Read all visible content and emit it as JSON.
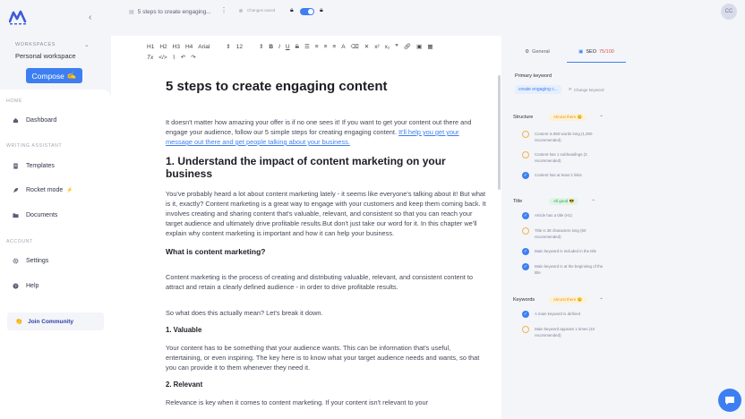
{
  "sidebar": {
    "workspaces_label": "WORKSPACES",
    "workspace_name": "Personal workspace",
    "compose_label": "Compose",
    "compose_emoji": "✍",
    "sections": {
      "home": "HOME",
      "writing": "WRITING ASSISTANT",
      "account": "ACCOUNT"
    },
    "items": [
      {
        "label": "Dashboard",
        "icon": "home-icon"
      },
      {
        "label": "Templates",
        "icon": "document-icon"
      },
      {
        "label": "Rocket mode",
        "icon": "rocket-icon",
        "badge": "⚡"
      },
      {
        "label": "Documents",
        "icon": "folder-icon"
      },
      {
        "label": "Settings",
        "icon": "gear-icon"
      },
      {
        "label": "Help",
        "icon": "help-icon"
      }
    ],
    "community_label": "Join Community",
    "community_emoji": "👏"
  },
  "topbar": {
    "doc_title": "5 steps to create engaging...",
    "saved_text": "Changes saved",
    "avatar_initials": "CC"
  },
  "toolbar": {
    "headings": [
      "H1",
      "H2",
      "H3",
      "H4"
    ],
    "font": "Arial",
    "size": "12"
  },
  "document": {
    "title": "5 steps to create engaging content",
    "intro": "It doesn't matter how amazing your offer is if no one sees it! If you want to get your content out there and engage your audience, follow our 5 simple steps for creating engaging content. ",
    "intro_link": "It'll help you get your message out there and get people talking about your business.",
    "h2_1": "1. Understand the impact of content marketing on your business",
    "p1": "You've probably heard a lot about content marketing lately - it seems like everyone's talking about it! But what is it, exactly? Content marketing is a great way to engage with your customers and keep them coming back. It involves creating and sharing content that's valuable, relevant, and consistent so that you can reach your target audience and ultimately drive profitable results.But don't just take our word for it. In this chapter we'll explain why content marketing is important and how it can help your business.",
    "h3_1": "What is content marketing?",
    "p2": "Content marketing is the process of creating and distributing valuable, relevant, and consistent content to attract and retain a clearly defined audience - in order to drive profitable results.",
    "p3": "So what does this actually mean? Let's break it down.",
    "h4_1": "1. Valuable",
    "p4": "Your content has to be something that your audience wants. This can be information that's useful, entertaining, or even inspiring. The key here is to know what your target audience needs and wants, so that you can provide it to them whenever they need it.",
    "h4_2": "2. Relevant",
    "p5": "Relevance is key when it comes to content marketing. If your content isn't relevant to your"
  },
  "panel": {
    "tab_general": "General",
    "tab_seo": "SEO",
    "seo_score": "75/100",
    "primary_keyword_label": "Primary keyword",
    "keyword": "create engaging c...",
    "change_keyword": "Change keyword",
    "structure": {
      "title": "Structure",
      "badge": "Almost there 😊",
      "checks": [
        {
          "text": "Content is 860 words long (1,000 recommended)",
          "done": false
        },
        {
          "text": "Content has 1 subheadings (3 recommended)",
          "done": false
        },
        {
          "text": "Content has at least 2 links",
          "done": true
        }
      ]
    },
    "title_sec": {
      "title": "Title",
      "badge": "All good 😎",
      "checks": [
        {
          "text": "Article has a title (H1)",
          "done": true
        },
        {
          "text": "Title is 38 characters long (60 recommended)",
          "done": false
        },
        {
          "text": "Main keyword is included in the title",
          "done": true
        },
        {
          "text": "Main keyword is at the beginning of the title",
          "done": true
        }
      ]
    },
    "keywords": {
      "title": "Keywords",
      "badge": "Almost there 😊",
      "checks": [
        {
          "text": "A main keyword is defined",
          "done": true
        },
        {
          "text": "Main keyword appears 1 times (10 recommended)",
          "done": false
        }
      ]
    }
  }
}
